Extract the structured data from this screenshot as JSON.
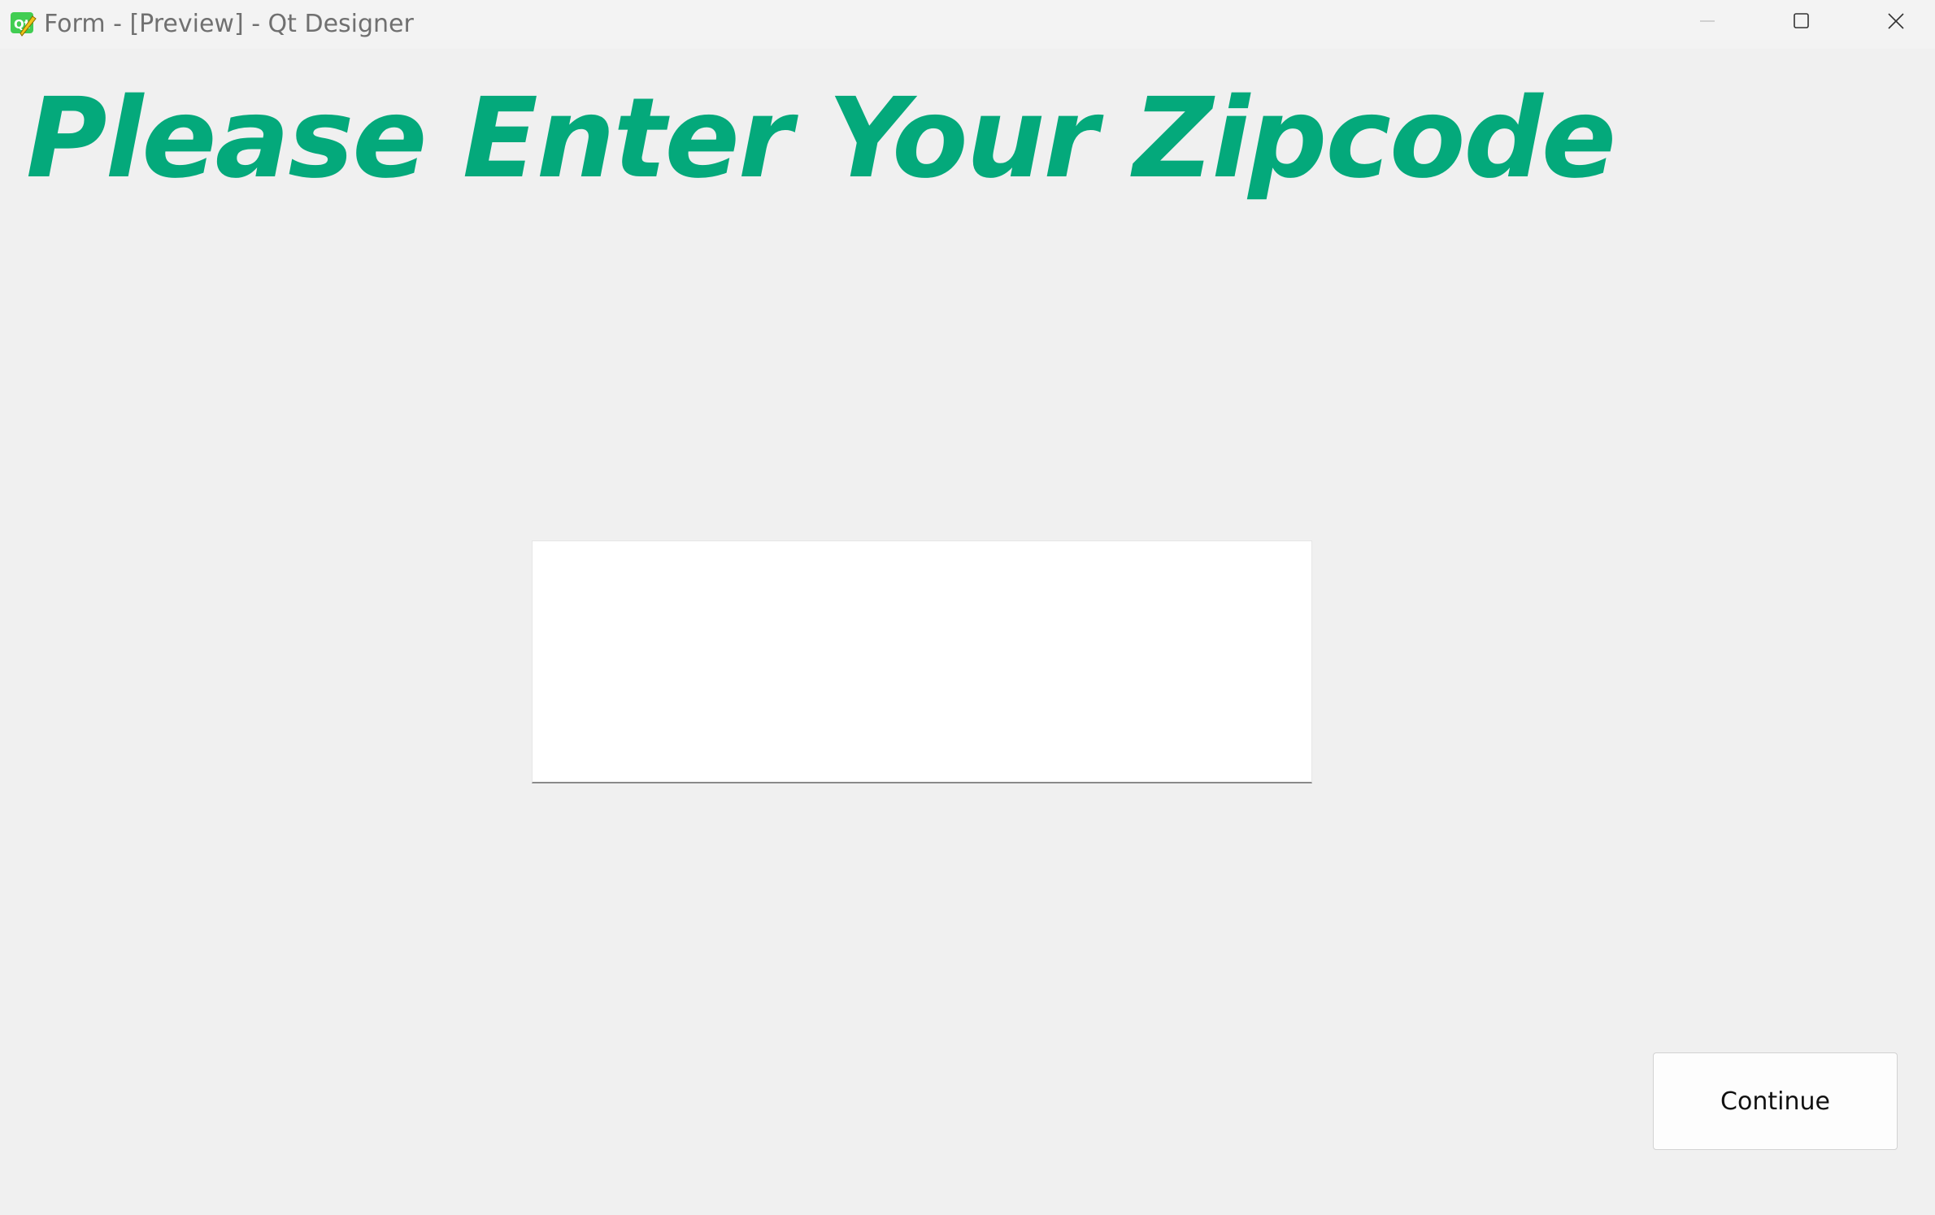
{
  "window": {
    "title": "Form - [Preview] - Qt Designer",
    "controls": {
      "minimize_icon": "minimize-icon",
      "maximize_icon": "maximize-icon",
      "close_icon": "close-icon"
    },
    "app_icon": "qt-designer-icon"
  },
  "form": {
    "heading": "Please Enter Your Zipcode",
    "zipcode_input": {
      "value": "",
      "placeholder": ""
    },
    "continue_label": "Continue"
  },
  "colors": {
    "heading": "#04a97b",
    "background": "#f0f0f0",
    "input_background": "#ffffff"
  }
}
